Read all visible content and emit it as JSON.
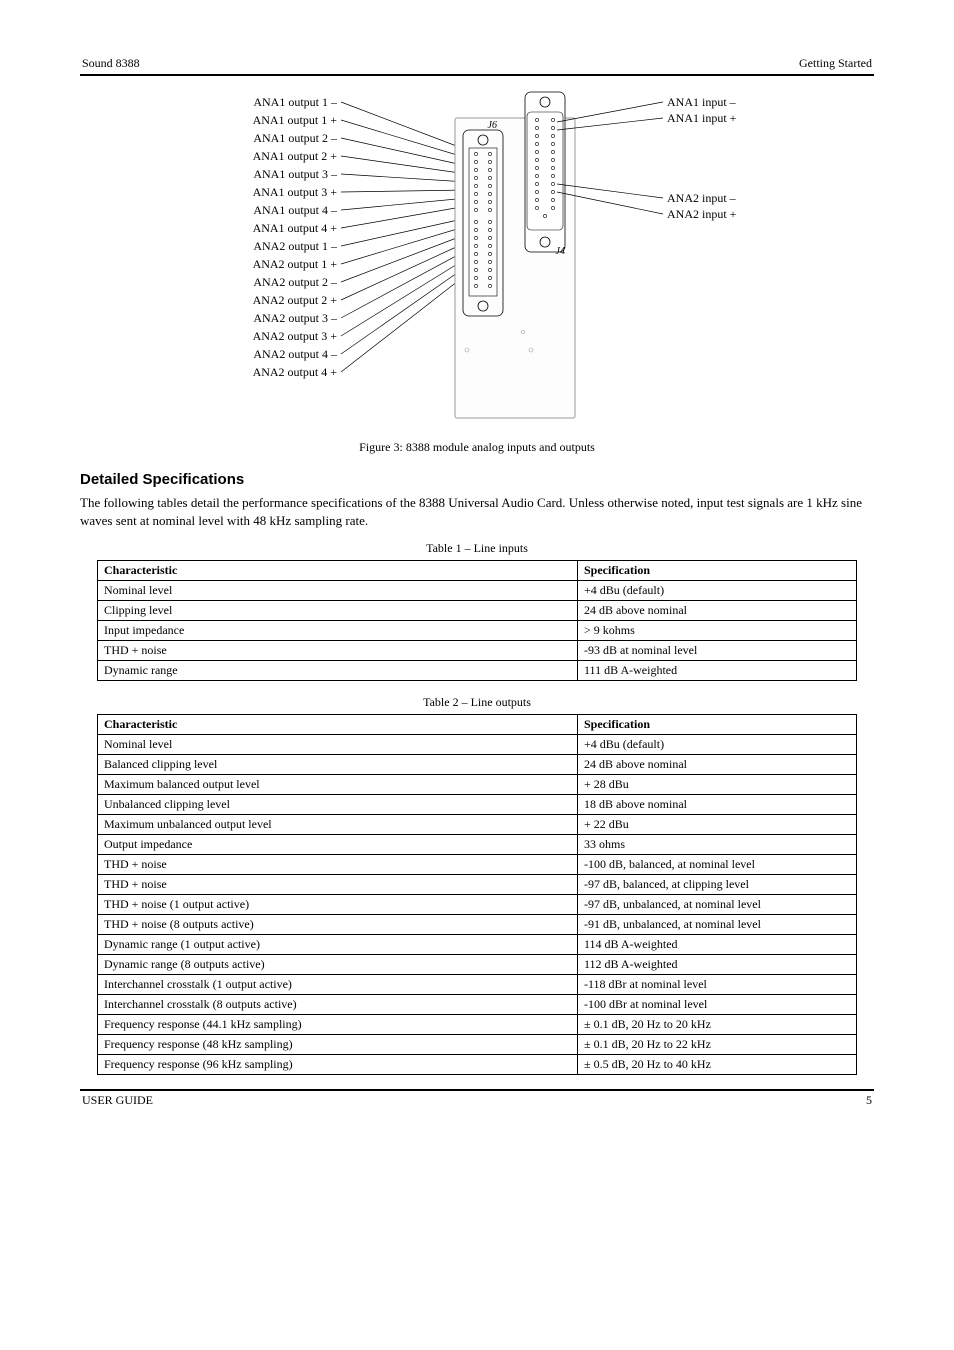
{
  "header": {
    "left": "Sound 8388",
    "right": "Getting Started"
  },
  "figure": {
    "caption": "Figure 3: 8388 module analog inputs and outputs",
    "left_labels": [
      "ANA1 output 1 –",
      "ANA1 output 1 +",
      "ANA1 output 2 –",
      "ANA1 output 2 +",
      "ANA1 output 3 –",
      "ANA1 output 3 +",
      "ANA1 output 4 –",
      "ANA1 output 4 +",
      "ANA2 output 1 –",
      "ANA2 output 1 +",
      "ANA2 output 2 –",
      "ANA2 output 2 +",
      "ANA2 output 3 –",
      "ANA2 output 3 +",
      "ANA2 output 4 –",
      "ANA2 output 4 +"
    ],
    "right_labels_top": [
      "ANA1 input –",
      "ANA1 input +"
    ],
    "right_labels_mid": [
      "ANA2 input –",
      "ANA2 input +"
    ],
    "conn_top_label": "J6",
    "conn_side_label": "J4"
  },
  "section": {
    "title": "Detailed Specifications",
    "body": "The following tables detail the performance specifications of the 8388 Universal Audio Card. Unless otherwise noted, input test signals are 1 kHz sine waves sent at nominal level with 48 kHz sampling rate.",
    "table1_caption": "Table 1 – Line inputs",
    "table2_caption": "Table 2 – Line outputs",
    "table1": {
      "headers": [
        "Characteristic",
        "Specification"
      ],
      "rows": [
        [
          "Nominal level",
          "+4 dBu (default)"
        ],
        [
          "Clipping level",
          "24 dB above nominal"
        ],
        [
          "Input impedance",
          "> 9 kohms"
        ],
        [
          "THD + noise",
          "-93 dB at nominal level"
        ],
        [
          "Dynamic range",
          "111 dB A-weighted"
        ]
      ]
    },
    "table2": {
      "headers": [
        "Characteristic",
        "Specification"
      ],
      "rows": [
        [
          "Nominal level",
          "+4 dBu (default)"
        ],
        [
          "Balanced clipping level",
          "24 dB above nominal"
        ],
        [
          "Maximum balanced output level",
          "+ 28 dBu"
        ],
        [
          "Unbalanced clipping level",
          "18 dB above nominal"
        ],
        [
          "Maximum unbalanced output level",
          "+ 22 dBu"
        ],
        [
          "Output impedance",
          "33 ohms"
        ],
        [
          "THD + noise",
          "-100 dB, balanced, at nominal level"
        ],
        [
          "THD + noise",
          "-97 dB, balanced, at clipping level"
        ],
        [
          "THD + noise (1 output active)",
          "-97 dB, unbalanced, at nominal level"
        ],
        [
          "THD + noise (8 outputs active)",
          "-91 dB, unbalanced, at nominal level"
        ],
        [
          "Dynamic range (1 output active)",
          "114 dB  A-weighted"
        ],
        [
          "Dynamic range (8 outputs active)",
          "112 dB  A-weighted"
        ],
        [
          "Interchannel crosstalk (1 output active)",
          "-118 dBr at nominal level"
        ],
        [
          "Interchannel crosstalk (8 outputs active)",
          "-100 dBr at nominal level"
        ],
        [
          "Frequency response (44.1 kHz sampling)",
          "± 0.1 dB, 20 Hz to 20 kHz"
        ],
        [
          "Frequency response (48 kHz sampling)",
          "± 0.1 dB, 20 Hz to 22 kHz"
        ],
        [
          "Frequency response (96 kHz sampling)",
          "± 0.5 dB, 20 Hz to 40 kHz"
        ]
      ]
    }
  },
  "footer": {
    "left": "USER GUIDE",
    "right": "5"
  }
}
